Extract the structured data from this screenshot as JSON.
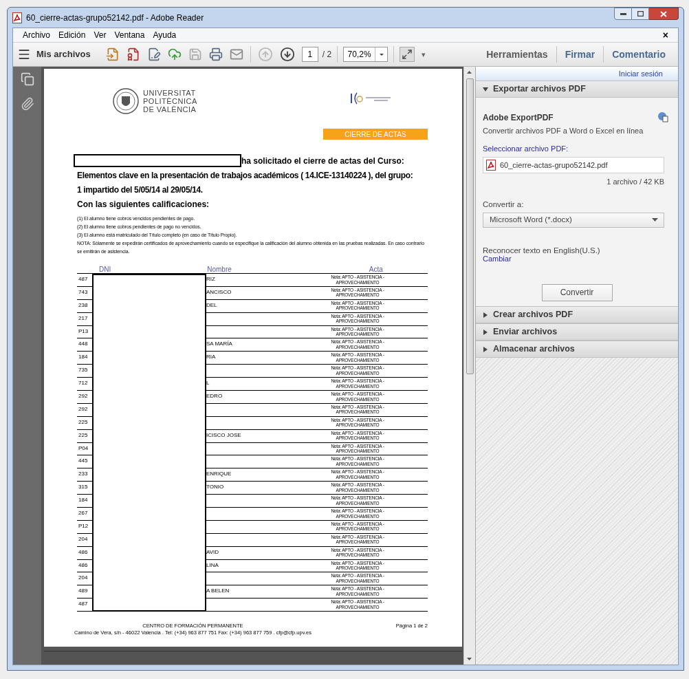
{
  "window": {
    "title": "60_cierre-actas-grupo52142.pdf - Adobe Reader"
  },
  "menu": [
    "Archivo",
    "Edición",
    "Ver",
    "Ventana",
    "Ayuda"
  ],
  "menu_close": "×",
  "toolbar": {
    "my_files": "Mis archivos",
    "page": "1",
    "page_total": "/ 2",
    "zoom": "70,2%",
    "more": "▾",
    "panes": [
      "Herramientas",
      "Firmar",
      "Comentario"
    ]
  },
  "document": {
    "university": [
      "UNIVERSITAT",
      "POLITÈCNICA",
      "DE VALÈNCIA"
    ],
    "banner": "CIERRE DE ACTAS",
    "intro": "ha solicitado el cierre de actas del Curso:",
    "course_lines": [
      "Elementos clave en la presentación de trabajos académicos ( 14.ICE-13140224 ), del grupo:",
      "1 impartido del 5/05/14 al 29/05/14."
    ],
    "subtitle": "Con las siguientes calificaciones:",
    "notes": [
      "(1) El alumno tiene cobros vencidos pendientes de pago.",
      "(2) El alumno tiene cobros pendientes de pago no vencidos.",
      "(3) El alumno está matriculado del Título completo (en caso de Título Propio).",
      "NOTA: Sólamente se expedirán certificados de aprovechamiento cuando se especifique la calificación del alumno obtenida en las pruebas realizadas. En caso contrario se emitirán de asistencia."
    ],
    "columns": [
      "DNI",
      "Nombre",
      "Acta"
    ],
    "rows": [
      {
        "dni": "487",
        "name": "RIZ",
        "acta": "Nota: APTO - ASISTENCIA - APROVECHAMIENTO"
      },
      {
        "dni": "743",
        "name": "ANCISCO",
        "acta": "Nota: APTO - ASISTENCIA - APROVECHAMIENTO"
      },
      {
        "dni": "238",
        "name": "DEL",
        "acta": "Nota: APTO - ASISTENCIA - APROVECHAMIENTO"
      },
      {
        "dni": "217",
        "name": "",
        "acta": "Nota: APTO - ASISTENCIA - APROVECHAMIENTO"
      },
      {
        "dni": "P13",
        "name": "",
        "acta": "Nota: APTO - ASISTENCIA - APROVECHAMIENTO"
      },
      {
        "dni": "448",
        "name": "SA MARÍA",
        "acta": "Nota: APTO - ASISTENCIA - APROVECHAMIENTO"
      },
      {
        "dni": "184",
        "name": "RIA",
        "acta": "Nota: APTO - ASISTENCIA - APROVECHAMIENTO"
      },
      {
        "dni": "735",
        "name": "",
        "acta": "Nota: APTO - ASISTENCIA - APROVECHAMIENTO"
      },
      {
        "dni": "712",
        "name": "L",
        "acta": "Nota: APTO - ASISTENCIA - APROVECHAMIENTO"
      },
      {
        "dni": "292",
        "name": "EDRO",
        "acta": "Nota: APTO - ASISTENCIA - APROVECHAMIENTO"
      },
      {
        "dni": "292",
        "name": "",
        "acta": "Nota: APTO - ASISTENCIA - APROVECHAMIENTO"
      },
      {
        "dni": "225",
        "name": "",
        "acta": "Nota: APTO - ASISTENCIA - APROVECHAMIENTO"
      },
      {
        "dni": "225",
        "name": "ICISCO JOSE",
        "acta": "Nota: APTO - ASISTENCIA - APROVECHAMIENTO"
      },
      {
        "dni": "P04",
        "name": "",
        "acta": "Nota: APTO - ASISTENCIA - APROVECHAMIENTO"
      },
      {
        "dni": "445",
        "name": "",
        "acta": "Nota: APTO - ASISTENCIA - APROVECHAMIENTO"
      },
      {
        "dni": "233",
        "name": "ENRIQUE",
        "acta": "Nota: APTO - ASISTENCIA - APROVECHAMIENTO"
      },
      {
        "dni": "315",
        "name": "TONIO",
        "acta": "Nota: APTO - ASISTENCIA - APROVECHAMIENTO"
      },
      {
        "dni": "184",
        "name": "",
        "acta": "Nota: APTO - ASISTENCIA - APROVECHAMIENTO"
      },
      {
        "dni": "267",
        "name": "",
        "acta": "Nota: APTO - ASISTENCIA - APROVECHAMIENTO"
      },
      {
        "dni": "P12",
        "name": "",
        "acta": "Nota: APTO - ASISTENCIA - APROVECHAMIENTO"
      },
      {
        "dni": "204",
        "name": "",
        "acta": "Nota: APTO - ASISTENCIA - APROVECHAMIENTO"
      },
      {
        "dni": "486",
        "name": "AVID",
        "acta": "Nota: APTO - ASISTENCIA - APROVECHAMIENTO"
      },
      {
        "dni": "486",
        "name": "LINA",
        "acta": "Nota: APTO - ASISTENCIA - APROVECHAMIENTO"
      },
      {
        "dni": "204",
        "name": "",
        "acta": "Nota: APTO - ASISTENCIA - APROVECHAMIENTO"
      },
      {
        "dni": "489",
        "name": "A BELEN",
        "acta": "Nota: APTO - ASISTENCIA - APROVECHAMIENTO"
      },
      {
        "dni": "487",
        "name": "",
        "acta": "Nota: APTO - ASISTENCIA - APROVECHAMIENTO"
      }
    ],
    "footer": [
      "CENTRO DE FORMACIÓN PERMANENTE",
      "Camino de Vera, s/n - 46022 Valencia . Tel: (+34) 963 877 751 Fax: (+34) 963 877 759 . cfp@cfp.upv.es"
    ],
    "page_number": "Página 1 de 2"
  },
  "right_panel": {
    "sign_in": "Iniciar sesión",
    "sections": [
      {
        "title": "Exportar archivos PDF",
        "expanded": true
      },
      {
        "title": "Crear archivos PDF",
        "expanded": false
      },
      {
        "title": "Enviar archivos",
        "expanded": false
      },
      {
        "title": "Almacenar archivos",
        "expanded": false
      }
    ],
    "export": {
      "service": "Adobe ExportPDF",
      "description": "Convertir archivos PDF a Word o Excel en línea",
      "select_label": "Seleccionar archivo PDF:",
      "file": "60_cierre-actas-grupo52142.pdf",
      "file_info": "1 archivo / 42 KB",
      "convert_label": "Convertir a:",
      "format": "Microsoft Word (*.docx)",
      "ocr": "Reconocer texto en English(U.S.)",
      "change": "Cambiar",
      "button": "Convertir"
    }
  }
}
